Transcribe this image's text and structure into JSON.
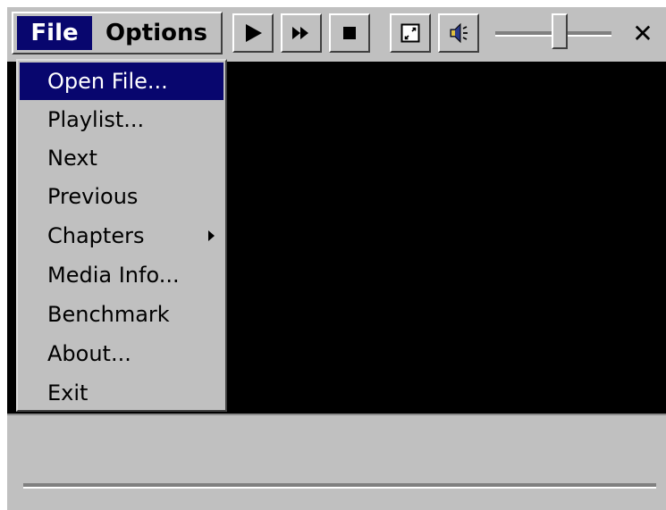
{
  "menubar": {
    "file_label": "File",
    "options_label": "Options"
  },
  "toolbar": {
    "buttons": [
      {
        "name": "play",
        "icon": "play-icon"
      },
      {
        "name": "fast-forward",
        "icon": "fast-forward-icon"
      },
      {
        "name": "stop",
        "icon": "stop-icon"
      },
      {
        "name": "fullscreen",
        "icon": "fullscreen-icon"
      },
      {
        "name": "mute",
        "icon": "speaker-icon"
      }
    ],
    "close_label": "✕"
  },
  "file_menu": {
    "items": [
      {
        "label": "Open File...",
        "selected": true,
        "submenu": false
      },
      {
        "label": "Playlist...",
        "selected": false,
        "submenu": false
      },
      {
        "label": "Next",
        "selected": false,
        "submenu": false
      },
      {
        "label": "Previous",
        "selected": false,
        "submenu": false
      },
      {
        "label": "Chapters",
        "selected": false,
        "submenu": true
      },
      {
        "label": "Media Info...",
        "selected": false,
        "submenu": false
      },
      {
        "label": "Benchmark",
        "selected": false,
        "submenu": false
      },
      {
        "label": "About...",
        "selected": false,
        "submenu": false
      },
      {
        "label": "Exit",
        "selected": false,
        "submenu": false
      }
    ]
  },
  "colors": {
    "face": "#c0c0c0",
    "highlight": "#08066e",
    "video_background": "#000000"
  }
}
